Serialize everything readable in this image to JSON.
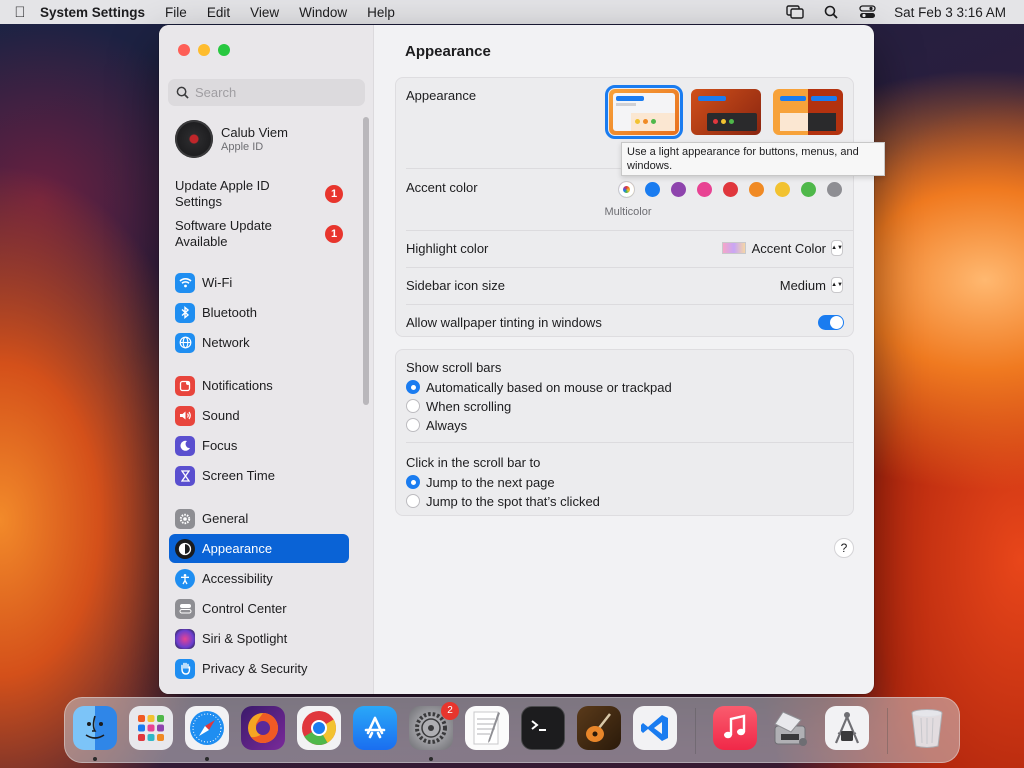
{
  "menubar": {
    "apple_icon": "apple-logo-icon",
    "app_name": "System Settings",
    "menus": [
      "File",
      "Edit",
      "View",
      "Window",
      "Help"
    ],
    "clock": "Sat Feb 3  3:16 AM"
  },
  "sidebar": {
    "search_placeholder": "Search",
    "account": {
      "name": "Calub Viem",
      "subtitle": "Apple ID"
    },
    "notices": [
      {
        "label": "Update Apple ID Settings",
        "badge": "1"
      },
      {
        "label": "Software Update Available",
        "badge": "1"
      }
    ],
    "items": [
      {
        "label": "Wi-Fi",
        "icon": "wifi-icon",
        "color": "#1f8ef1"
      },
      {
        "label": "Bluetooth",
        "icon": "bluetooth-icon",
        "color": "#1f8ef1"
      },
      {
        "label": "Network",
        "icon": "globe-icon",
        "color": "#1f8ef1"
      },
      {
        "label": "Notifications",
        "icon": "bell-icon",
        "color": "#e8453c"
      },
      {
        "label": "Sound",
        "icon": "speaker-icon",
        "color": "#e8453c"
      },
      {
        "label": "Focus",
        "icon": "moon-icon",
        "color": "#5a4fcf"
      },
      {
        "label": "Screen Time",
        "icon": "hourglass-icon",
        "color": "#5a4fcf"
      },
      {
        "label": "General",
        "icon": "gear-icon",
        "color": "#8e8e93"
      },
      {
        "label": "Appearance",
        "icon": "appearance-icon",
        "color": "#1c1c1e",
        "active": true
      },
      {
        "label": "Accessibility",
        "icon": "accessibility-icon",
        "color": "#1f8ef1"
      },
      {
        "label": "Control Center",
        "icon": "toggles-icon",
        "color": "#8e8e93"
      },
      {
        "label": "Siri & Spotlight",
        "icon": "siri-icon",
        "color": "#6a3fcf"
      },
      {
        "label": "Privacy & Security",
        "icon": "hand-icon",
        "color": "#1f8ef1"
      }
    ]
  },
  "content": {
    "title": "Appearance",
    "appearance_label": "Appearance",
    "tooltip": "Use a light appearance for buttons, menus, and windows.",
    "accent_label": "Accent color",
    "accent_selected_name": "Multicolor",
    "accent_colors": [
      "multicolor",
      "#1a7cf0",
      "#8e44ad",
      "#e84393",
      "#e0373d",
      "#f08a24",
      "#f2c230",
      "#4fb84a",
      "#8e8e93"
    ],
    "highlight_label": "Highlight color",
    "highlight_value": "Accent Color",
    "icon_size_label": "Sidebar icon size",
    "icon_size_value": "Medium",
    "tinting_label": "Allow wallpaper tinting in windows",
    "tinting_on": true,
    "scroll_label": "Show scroll bars",
    "scroll_options": [
      "Automatically based on mouse or trackpad",
      "When scrolling",
      "Always"
    ],
    "click_label": "Click in the scroll bar to",
    "click_options": [
      "Jump to the next page",
      "Jump to the spot that’s clicked"
    ],
    "help": "?"
  },
  "dock": {
    "apps": [
      {
        "name": "Finder",
        "icon": "finder-icon",
        "color": "#3b8ff0"
      },
      {
        "name": "Launchpad",
        "icon": "launchpad-icon",
        "color": "#e5e5ea"
      },
      {
        "name": "Safari",
        "icon": "safari-icon",
        "color": "#1f8ef1"
      },
      {
        "name": "Firefox",
        "icon": "firefox-icon",
        "color": "#f05a24"
      },
      {
        "name": "Chrome",
        "icon": "chrome-icon",
        "color": "#f2f2f2"
      },
      {
        "name": "App Store",
        "icon": "app-store-icon",
        "color": "#1f8ef1"
      },
      {
        "name": "System Settings",
        "icon": "gear-icon",
        "color": "#8e8e93",
        "badge": "2"
      },
      {
        "name": "TextEdit",
        "icon": "notepad-icon",
        "color": "#f2f2f2"
      },
      {
        "name": "Terminal",
        "icon": "terminal-icon",
        "color": "#1c1c1e"
      },
      {
        "name": "GarageBand",
        "icon": "guitar-icon",
        "color": "#3a2a1a"
      },
      {
        "name": "Visual Studio Code",
        "icon": "vscode-icon",
        "color": "#f2f2f2"
      },
      {
        "name": "Music",
        "icon": "music-icon",
        "color": "#f5435a"
      },
      {
        "name": "Migration",
        "icon": "disk-utility-icon",
        "color": "#d8d8dc"
      },
      {
        "name": "Archive Utility",
        "icon": "compass-icon",
        "color": "#f2f2f2"
      },
      {
        "name": "Trash",
        "icon": "trash-icon",
        "color": "#e5e5ea"
      }
    ]
  }
}
